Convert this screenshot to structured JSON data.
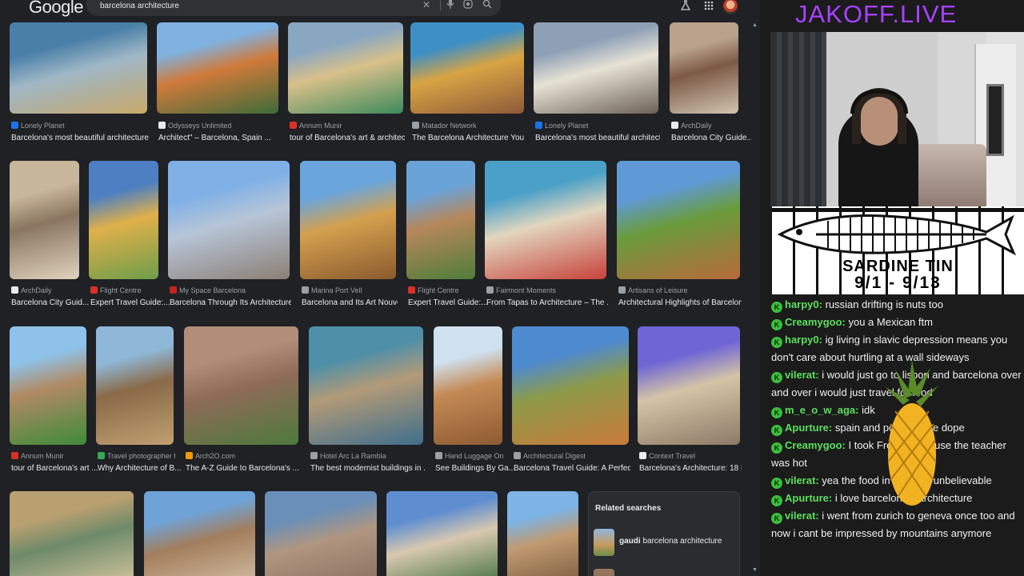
{
  "google": {
    "logo": "Google",
    "query": "barcelona architecture",
    "related_title": "Related searches",
    "related": [
      {
        "bold": "gaudi",
        "rest": " barcelona architecture"
      }
    ],
    "rows": [
      [
        {
          "source": "Lonely Planet",
          "caption": "Barcelona's most beautiful architecture ...",
          "fav": "#1a73e8",
          "colors": [
            "#4a7fa8",
            "#9fb7c6",
            "#c9a86a"
          ]
        },
        {
          "source": "Odysseys Unlimited",
          "caption": "Architect\" – Barcelona, Spain ...",
          "fav": "#e8eaed",
          "colors": [
            "#7fb2e0",
            "#d07a3a",
            "#3e6b3a"
          ]
        },
        {
          "source": "Annum Munir",
          "caption": "tour of Barcelona's art & architect...",
          "fav": "#d93025",
          "colors": [
            "#8aa7c2",
            "#d9c08a",
            "#3d8a5c"
          ]
        },
        {
          "source": "Matador Network",
          "caption": "The Barcelona Architecture You N...",
          "fav": "#9aa0a6",
          "colors": [
            "#3e8fc4",
            "#d8a443",
            "#8d5a3a"
          ]
        },
        {
          "source": "Lonely Planet",
          "caption": "Barcelona's most beautiful architectur...",
          "fav": "#1a73e8",
          "colors": [
            "#8ea0b5",
            "#e7e2d6",
            "#6c6055"
          ]
        },
        {
          "source": "ArchDaily",
          "caption": "Barcelona City Guide...",
          "fav": "#e8eaed",
          "colors": [
            "#b9a28c",
            "#7d5a46",
            "#d0c4b0"
          ]
        }
      ],
      [
        {
          "source": "ArchDaily",
          "caption": "Barcelona City Guid...",
          "fav": "#e8eaed",
          "colors": [
            "#c9b79c",
            "#8a7660",
            "#e0d3bd"
          ]
        },
        {
          "source": "Flight Centre",
          "caption": "Expert Travel Guide:...",
          "fav": "#d93025",
          "colors": [
            "#4d7fc2",
            "#e0b04a",
            "#6e9d4a"
          ]
        },
        {
          "source": "My Space Barcelona",
          "caption": "Barcelona Through Its Architecture ...",
          "fav": "#c5221f",
          "colors": [
            "#7fb0e6",
            "#b7c5d8",
            "#8b7f74"
          ]
        },
        {
          "source": "Marina Port Vell",
          "caption": "Barcelona and Its Art Nouve...",
          "fav": "#9aa0a6",
          "colors": [
            "#6aa6dd",
            "#d4a04e",
            "#8a5a2e"
          ]
        },
        {
          "source": "Flight Centre",
          "caption": "Expert Travel Guide:...",
          "fav": "#d93025",
          "colors": [
            "#6aa3d8",
            "#b7875b",
            "#4f7d3a"
          ]
        },
        {
          "source": "Fairmont Moments",
          "caption": "From Tapas to Architecture – The ...",
          "fav": "#9aa0a6",
          "colors": [
            "#4aa0c8",
            "#e2d6bf",
            "#c8423a"
          ]
        },
        {
          "source": "Artisans of Leisure",
          "caption": "Architectural Highlights of Barcelona ...",
          "fav": "#9aa0a6",
          "colors": [
            "#5f9ad6",
            "#6a9b3c",
            "#b86a3c"
          ]
        }
      ],
      [
        {
          "source": "Annum Munir",
          "caption": "tour of Barcelona's art ...",
          "fav": "#d93025",
          "colors": [
            "#8fc2ea",
            "#b08a63",
            "#3e8b3a"
          ]
        },
        {
          "source": "Travel photographer fro...",
          "caption": "Why Architecture of B...",
          "fav": "#34a853",
          "colors": [
            "#8fb8d8",
            "#8a6a48",
            "#c0a070"
          ]
        },
        {
          "source": "Arch2O.com",
          "caption": "The A-Z Guide to Barcelona's ...",
          "fav": "#f29900",
          "colors": [
            "#b08e78",
            "#8f6b58",
            "#4d7a3c"
          ]
        },
        {
          "source": "Hotel Arc La Rambla",
          "caption": "The best modernist buildings in ...",
          "fav": "#9aa0a6",
          "colors": [
            "#4f8fa8",
            "#b39a78",
            "#3e6e8c"
          ]
        },
        {
          "source": "Hand Luggage Only",
          "caption": "See Buildings By Ga...",
          "fav": "#9aa0a6",
          "colors": [
            "#cfe0ee",
            "#c48a55",
            "#8e5a32"
          ]
        },
        {
          "source": "Architectural Digest",
          "caption": "Barcelona Travel Guide: A Perfect ...",
          "fav": "#9aa0a6",
          "colors": [
            "#4e8ad0",
            "#8e9a4a",
            "#c97a3a"
          ]
        },
        {
          "source": "Context Travel",
          "caption": "Barcelona's Architecture: 18 B...",
          "fav": "#e8eaed",
          "colors": [
            "#6f66d6",
            "#d4c4a6",
            "#8b7a66"
          ]
        }
      ],
      [
        {
          "colors": [
            "#b9a070",
            "#6e8a6a",
            "#d8c8a0"
          ]
        },
        {
          "colors": [
            "#6fa3d8",
            "#a37e5c",
            "#d3c0a6"
          ]
        },
        {
          "colors": [
            "#6a8fb8",
            "#b09680",
            "#8a6e5e"
          ]
        },
        {
          "colors": [
            "#5f8ed0",
            "#d8c8b0",
            "#3e6e3a"
          ]
        },
        {
          "colors": [
            "#7db3e5",
            "#c09a70",
            "#7a5a3e"
          ]
        }
      ]
    ]
  },
  "stream": {
    "brand": "JAKOFF.LIVE",
    "tin_line1": "SARDINE TIN",
    "tin_line2": "9/1 - 9/13",
    "brand_color": "#a642ff",
    "user_color": "#5ce05c",
    "chat": [
      {
        "user": "harpy0",
        "text": "russian drifting is nuts too"
      },
      {
        "user": "Creamygoo",
        "text": "you a Mexican ftm"
      },
      {
        "user": "harpy0",
        "text": "ig living in slavic depression means you don't care about hurtling at a wall sideways"
      },
      {
        "user": "vilerat",
        "text": "i would just go to lisbon and barcelona over and over i would just travel for food"
      },
      {
        "user": "m_e_o_w_aga",
        "text": "idk"
      },
      {
        "user": "Apurture",
        "text": "spain and portugal are dope"
      },
      {
        "user": "Creamygoo",
        "text": "I took French because the teacher was hot"
      },
      {
        "user": "vilerat",
        "text": "yea the food in lisbon is unbelievable"
      },
      {
        "user": "Apurture",
        "text": "i love barcelona's architecture"
      },
      {
        "user": "vilerat",
        "text": "i went from zurich to geneva once too and now i cant be impressed by mountains anymore"
      }
    ]
  }
}
